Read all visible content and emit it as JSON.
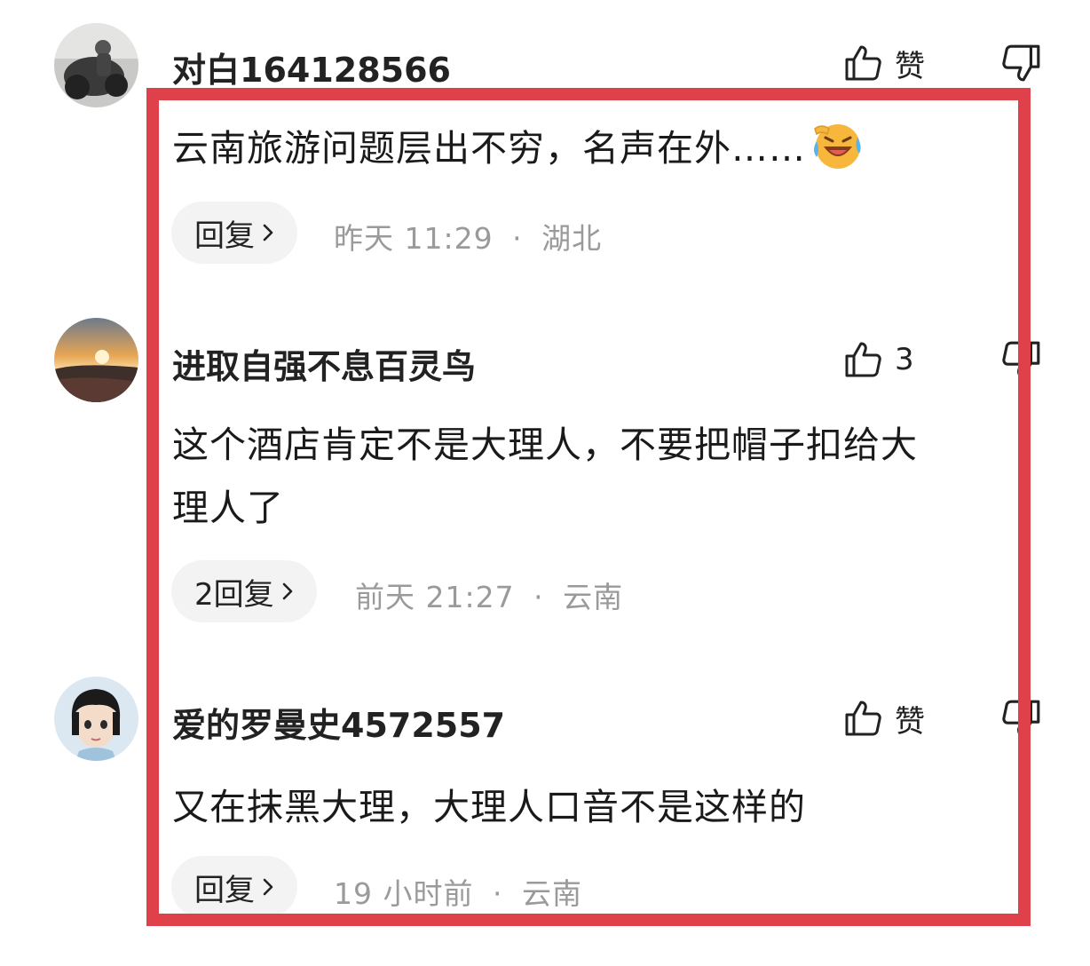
{
  "comments": [
    {
      "username": "对白164128566",
      "like_label": "赞",
      "text": "云南旅游问题层出不穷，名声在外……",
      "emoji": "laughing-crying-face",
      "reply_label": "回复",
      "time": "昨天 11:29",
      "separator": "·",
      "location": "湖北"
    },
    {
      "username": "进取自强不息百灵鸟",
      "like_label": "3",
      "text_line1": "这个酒店肯定不是大理人，不要把帽子扣给大",
      "text_line2": "理人了",
      "reply_label": "2回复",
      "time": "前天 21:27",
      "separator": "·",
      "location": "云南"
    },
    {
      "username": "爱的罗曼史4572557",
      "like_label": "赞",
      "text": "又在抹黑大理，大理人口音不是这样的",
      "reply_label": "回复",
      "time": "19 小时前",
      "separator": "·",
      "location": "云南"
    }
  ],
  "icons": {
    "like": "thumbs-up-icon",
    "dislike": "thumbs-down-icon",
    "chevron": "chevron-right-icon"
  },
  "colors": {
    "highlight": "#e0404a",
    "meta_text": "#9a9a9a",
    "pill_bg": "#f3f3f3"
  }
}
